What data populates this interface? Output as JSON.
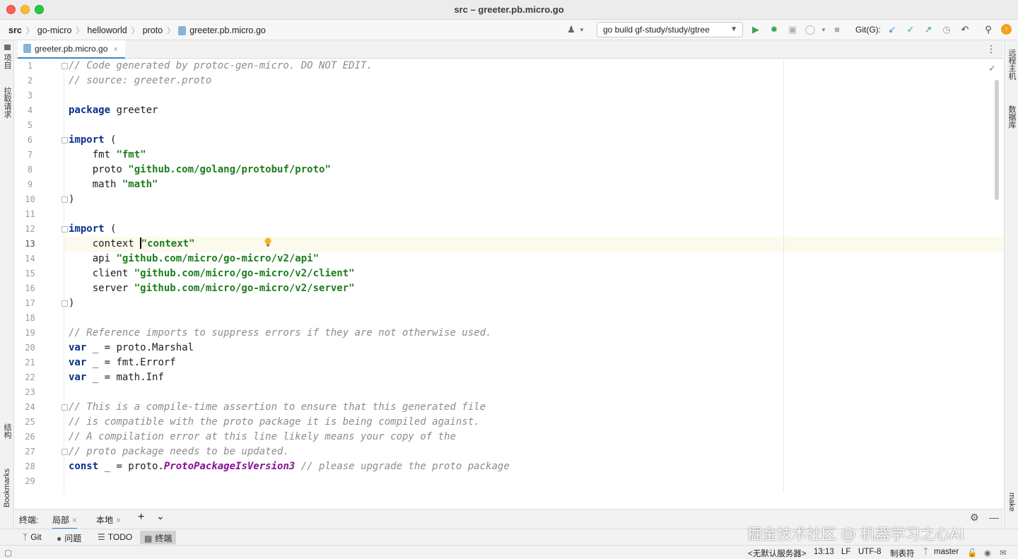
{
  "window": {
    "title": "src – greeter.pb.micro.go"
  },
  "breadcrumbs": [
    "src",
    "go-micro",
    "helloworld",
    "proto",
    "greeter.pb.micro.go"
  ],
  "run_config": {
    "label": "go build gf-study/study/gtree"
  },
  "git_label": "Git(G):",
  "left_tool_windows": [
    "项目",
    "拉取请求",
    "结构",
    "Bookmarks"
  ],
  "right_tool_windows": [
    "远程主机",
    "数据库",
    "make"
  ],
  "editor_tab": {
    "label": "greeter.pb.micro.go",
    "close": "×"
  },
  "code": {
    "current_line": 13,
    "lines": [
      {
        "n": "1"
      },
      {
        "n": "2"
      },
      {
        "n": "3"
      },
      {
        "n": "4"
      },
      {
        "n": "5"
      },
      {
        "n": "6"
      },
      {
        "n": "7"
      },
      {
        "n": "8"
      },
      {
        "n": "9"
      },
      {
        "n": "10"
      },
      {
        "n": "11"
      },
      {
        "n": "12"
      },
      {
        "n": "13"
      },
      {
        "n": "14"
      },
      {
        "n": "15"
      },
      {
        "n": "16"
      },
      {
        "n": "17"
      },
      {
        "n": "18"
      },
      {
        "n": "19"
      },
      {
        "n": "20"
      },
      {
        "n": "21"
      },
      {
        "n": "22"
      },
      {
        "n": "23"
      },
      {
        "n": "24"
      },
      {
        "n": "25"
      },
      {
        "n": "26"
      },
      {
        "n": "27"
      },
      {
        "n": "28"
      },
      {
        "n": "29"
      }
    ],
    "text": {
      "l1": "// Code generated by protoc-gen-micro. DO NOT EDIT.",
      "l2": "// source: greeter.proto",
      "l4_kw": "package",
      "l4": " greeter",
      "l6_kw": "import",
      "l6": " (",
      "l7": "    fmt ",
      "l7_s": "\"fmt\"",
      "l8": "    proto ",
      "l8_s": "\"github.com/golang/protobuf/proto\"",
      "l9": "    math ",
      "l9_s": "\"math\"",
      "l10": ")",
      "l12_kw": "import",
      "l12": " (",
      "l13": "    context ",
      "l13_s": "\"context\"",
      "l14": "    api ",
      "l14_s": "\"github.com/micro/go-micro/v2/api\"",
      "l15": "    client ",
      "l15_s": "\"github.com/micro/go-micro/v2/client\"",
      "l16": "    server ",
      "l16_s": "\"github.com/micro/go-micro/v2/server\"",
      "l17": ")",
      "l19": "// Reference imports to suppress errors if they are not otherwise used.",
      "l20_kw": "var",
      "l20": " _ = proto.Marshal",
      "l21_kw": "var",
      "l21": " _ = fmt.Errorf",
      "l22_kw": "var",
      "l22": " _ = math.Inf",
      "l24": "// This is a compile-time assertion to ensure that this generated file",
      "l25": "// is compatible with the proto package it is being compiled against.",
      "l26": "// A compilation error at this line likely means your copy of the",
      "l27": "// proto package needs to be updated.",
      "l28_kw": "const",
      "l28_a": " _ = proto.",
      "l28_fn": "ProtoPackageIsVersion3",
      "l28_cm": " // please upgrade the proto package"
    }
  },
  "terminal": {
    "label": "终端:",
    "tabs": [
      "局部",
      "本地"
    ],
    "add": "+",
    "more": "⌄"
  },
  "bottom_tools": [
    {
      "label": "Git"
    },
    {
      "label": "问题"
    },
    {
      "label": "TODO"
    },
    {
      "label": "终端",
      "active": true
    }
  ],
  "status": {
    "interpreter": "<无默认服务器>",
    "position": "13:13",
    "line_sep": "LF",
    "encoding": "UTF-8",
    "indent": "制表符",
    "branch": "master"
  },
  "watermark": "掘金技术社区 @ 机器学习之心AI"
}
